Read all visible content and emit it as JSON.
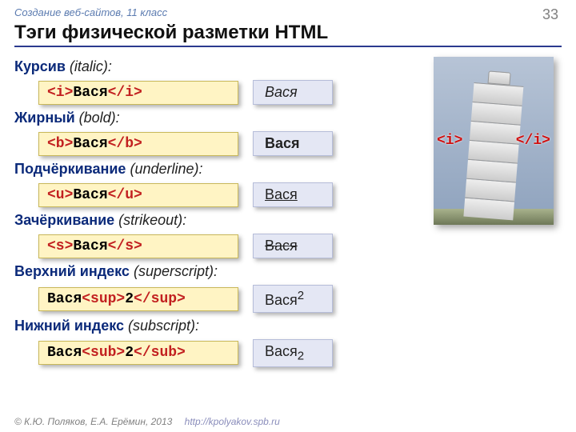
{
  "header": {
    "course": "Создание веб-сайтов, 11 класс",
    "page": "33"
  },
  "title": "Тэги физической разметки HTML",
  "image": {
    "open_tag": "<i>",
    "close_tag": "</i>"
  },
  "sections": [
    {
      "ru": "Курсив",
      "en": "italic",
      "code_pre": "",
      "tag_open": "<i>",
      "inner": "Вася",
      "tag_close": "</i>",
      "code_post": "",
      "result_html": "<i>Вася</i>"
    },
    {
      "ru": "Жирный",
      "en": "bold",
      "code_pre": "",
      "tag_open": "<b>",
      "inner": "Вася",
      "tag_close": "</b>",
      "code_post": "",
      "result_html": "<b>Вася</b>"
    },
    {
      "ru": "Подчёркивание",
      "en": "underline",
      "code_pre": "",
      "tag_open": "<u>",
      "inner": "Вася",
      "tag_close": "</u>",
      "code_post": "",
      "result_html": "<u>Вася</u>"
    },
    {
      "ru": "Зачёркивание",
      "en": "strikeout",
      "code_pre": "",
      "tag_open": "<s>",
      "inner": "Вася",
      "tag_close": "</s>",
      "code_post": "",
      "result_html": "<s>Вася</s>"
    },
    {
      "ru": "Верхний индекс",
      "en": "superscript",
      "code_pre": "Вася",
      "tag_open": "<sup>",
      "inner": "2",
      "tag_close": "</sup>",
      "code_post": "",
      "result_html": "Вася<sup>2</sup>"
    },
    {
      "ru": "Нижний индекс",
      "en": "subscript",
      "code_pre": "Вася",
      "tag_open": "<sub>",
      "inner": "2",
      "tag_close": "</sub>",
      "code_post": "",
      "result_html": "Вася<sub>2</sub>"
    }
  ],
  "footer": {
    "copyright": "© К.Ю. Поляков, Е.А. Ерёмин, 2013",
    "url": "http://kpolyakov.spb.ru"
  }
}
